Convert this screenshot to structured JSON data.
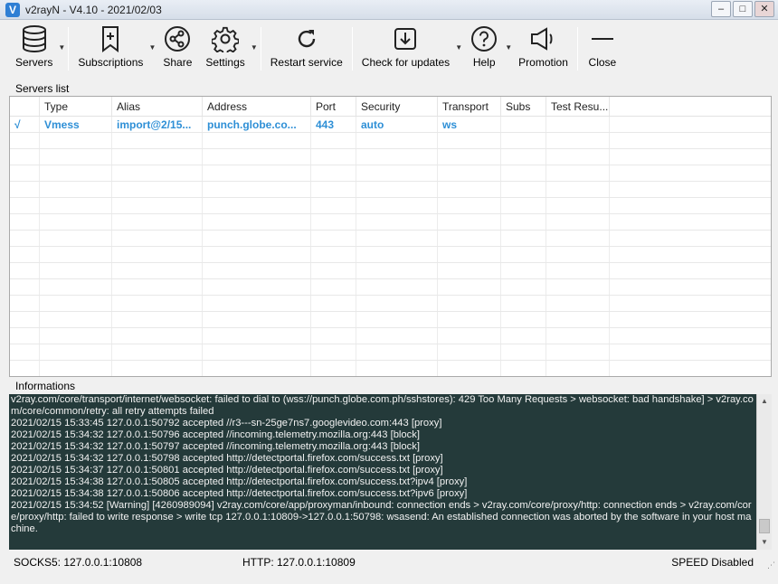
{
  "window": {
    "title": "v2rayN - V4.10 - 2021/02/03",
    "minimize": "–",
    "maximize": "□",
    "close": "✕"
  },
  "toolbar": {
    "servers": "Servers",
    "subscriptions": "Subscriptions",
    "share": "Share",
    "settings": "Settings",
    "restart_service": "Restart service",
    "check_for_updates": "Check for updates",
    "help": "Help",
    "promotion": "Promotion",
    "close": "Close"
  },
  "servers_list": {
    "group_title": "Servers list",
    "columns": [
      "",
      "Type",
      "Alias",
      "Address",
      "Port",
      "Security",
      "Transport",
      "Subs",
      "Test Resu..."
    ],
    "rows": [
      {
        "active": "√",
        "type": "Vmess",
        "alias": "import@2/15...",
        "address": "punch.globe.co...",
        "port": "443",
        "security": "auto",
        "transport": "ws",
        "subs": "",
        "test": ""
      }
    ]
  },
  "informations": {
    "group_title": "Informations",
    "lines": [
      "v2ray.com/core/transport/internet/websocket: failed to dial to (wss://punch.globe.com.ph/sshstores): 429 Too Many Requests > websocket: bad handshake] > v2ray.com/core/common/retry: all retry attempts failed",
      "2021/02/15 15:33:45 127.0.0.1:50792 accepted //r3---sn-25ge7ns7.googlevideo.com:443 [proxy]",
      "2021/02/15 15:34:32 127.0.0.1:50796 accepted //incoming.telemetry.mozilla.org:443 [block]",
      "2021/02/15 15:34:32 127.0.0.1:50797 accepted //incoming.telemetry.mozilla.org:443 [block]",
      "2021/02/15 15:34:32 127.0.0.1:50798 accepted http://detectportal.firefox.com/success.txt [proxy]",
      "2021/02/15 15:34:37 127.0.0.1:50801 accepted http://detectportal.firefox.com/success.txt [proxy]",
      "2021/02/15 15:34:38 127.0.0.1:50805 accepted http://detectportal.firefox.com/success.txt?ipv4 [proxy]",
      "2021/02/15 15:34:38 127.0.0.1:50806 accepted http://detectportal.firefox.com/success.txt?ipv6 [proxy]",
      "2021/02/15 15:34:52 [Warning] [4260989094] v2ray.com/core/app/proxyman/inbound: connection ends > v2ray.com/core/proxy/http: connection ends > v2ray.com/core/proxy/http: failed to write response > write tcp 127.0.0.1:10809->127.0.0.1:50798: wsasend: An established connection was aborted by the software in your host machine."
    ]
  },
  "statusbar": {
    "socks": "SOCKS5:  127.0.0.1:10808",
    "http": "HTTP:  127.0.0.1:10809",
    "speed": "SPEED Disabled"
  }
}
